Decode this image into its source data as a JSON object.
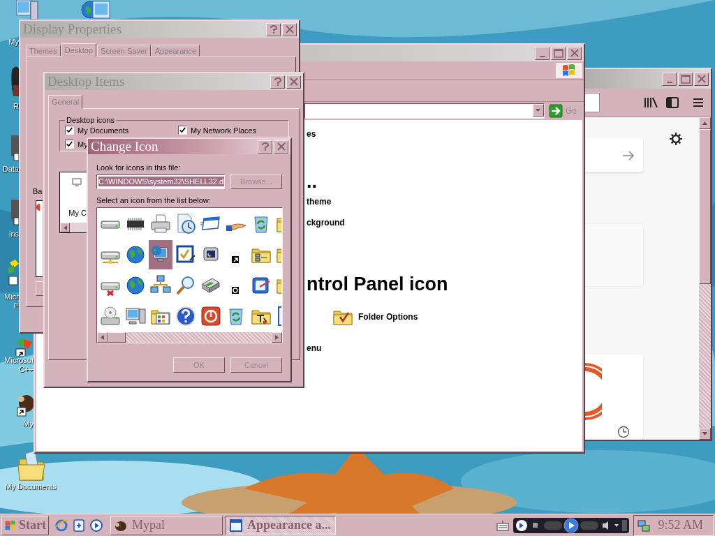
{
  "desktop": {
    "icons": [
      {
        "kind": "computer",
        "label": [
          "My"
        ]
      },
      {
        "kind": "network-computer"
      },
      {
        "kind": "figure",
        "label": [
          "R"
        ]
      },
      {
        "kind": "program",
        "label": [
          "Data"
        ]
      },
      {
        "kind": "program",
        "label": [
          "ins"
        ]
      },
      {
        "kind": "shortcut-green",
        "label": [
          "Micr",
          "E"
        ]
      },
      {
        "kind": "shortcut-cubes",
        "label": [
          "Microsof",
          "C++"
        ]
      },
      {
        "kind": "shortcut-animal",
        "label": [
          "My"
        ]
      },
      {
        "kind": "folder",
        "label": [
          "My Documents"
        ]
      }
    ]
  },
  "browser_window": {
    "active": false
  },
  "control_panel_window": {
    "active": false,
    "go": "Go",
    "lines": [
      {
        "kind": "link",
        "text": "es"
      },
      {
        "kind": "heading",
        "text": ".."
      },
      {
        "kind": "link",
        "text": "theme"
      },
      {
        "kind": "link",
        "text": "ckground"
      },
      {
        "kind": "heading",
        "text": "ntrol Panel icon"
      },
      {
        "kind": "item",
        "text": "Folder Options"
      },
      {
        "kind": "link",
        "text": "enu"
      }
    ]
  },
  "display_properties": {
    "title": "Display Properties",
    "active": false,
    "tabs": [
      {
        "label": "Themes",
        "selected": false
      },
      {
        "label": "Desktop",
        "selected": true
      },
      {
        "label": "Screen Saver",
        "selected": false
      },
      {
        "label": "Appearance",
        "selected": false
      }
    ],
    "label_fragment": "Ba"
  },
  "desktop_items": {
    "title": "Desktop Items",
    "active": false,
    "tabs": [
      {
        "label": "General",
        "selected": true
      }
    ],
    "group": "Desktop icons",
    "checkboxes": [
      {
        "label": "My Documents",
        "checked": true
      },
      {
        "label": "My Network Places",
        "checked": true
      },
      {
        "label": "My",
        "checked": true
      }
    ],
    "preview_label": "My C"
  },
  "change_icon": {
    "title": "Change Icon",
    "active": true,
    "file_label": "Look for icons in this file:",
    "file_value": "C:\\WINDOWS\\system32\\SHELL32.dl",
    "browse": "Browse...",
    "list_label": "Select an icon from the list below:",
    "icons": [
      {
        "kind": "drive",
        "selected": false
      },
      {
        "kind": "chip",
        "selected": false
      },
      {
        "kind": "printer",
        "selected": false
      },
      {
        "kind": "clock-document",
        "selected": false
      },
      {
        "kind": "window",
        "selected": false
      },
      {
        "kind": "hand",
        "selected": false
      },
      {
        "kind": "recycle-bin",
        "selected": false
      },
      {
        "kind": "folder",
        "selected": false
      },
      {
        "kind": "network-drive",
        "selected": false
      },
      {
        "kind": "globe",
        "selected": false
      },
      {
        "kind": "computer-globe",
        "selected": true
      },
      {
        "kind": "checklist",
        "selected": false
      },
      {
        "kind": "monitor",
        "selected": false
      },
      {
        "kind": "shortcut",
        "selected": false
      },
      {
        "kind": "network-folder",
        "selected": false
      },
      {
        "kind": "folder",
        "selected": false
      },
      {
        "kind": "drive-error",
        "selected": false
      },
      {
        "kind": "globe",
        "selected": false
      },
      {
        "kind": "network",
        "selected": false
      },
      {
        "kind": "magnifier",
        "selected": false
      },
      {
        "kind": "scanner",
        "selected": false
      },
      {
        "kind": "small-dial",
        "selected": false
      },
      {
        "kind": "arrow-panel",
        "selected": false
      },
      {
        "kind": "folder",
        "selected": false
      },
      {
        "kind": "disc-drive",
        "selected": false
      },
      {
        "kind": "computer",
        "selected": false
      },
      {
        "kind": "folder-grid",
        "selected": false
      },
      {
        "kind": "help",
        "selected": false
      },
      {
        "kind": "power",
        "selected": false
      },
      {
        "kind": "recycle-bin",
        "selected": false
      },
      {
        "kind": "folder-tools",
        "selected": false
      },
      {
        "kind": "document",
        "selected": false
      }
    ],
    "buttons": [
      "OK",
      "Cancel"
    ]
  },
  "taskbar": {
    "start": "Start",
    "tasks": [
      {
        "label": "Mypal",
        "selected": false
      },
      {
        "label": "Appearance a...",
        "selected": true
      }
    ],
    "clock": "9:52 AM"
  }
}
